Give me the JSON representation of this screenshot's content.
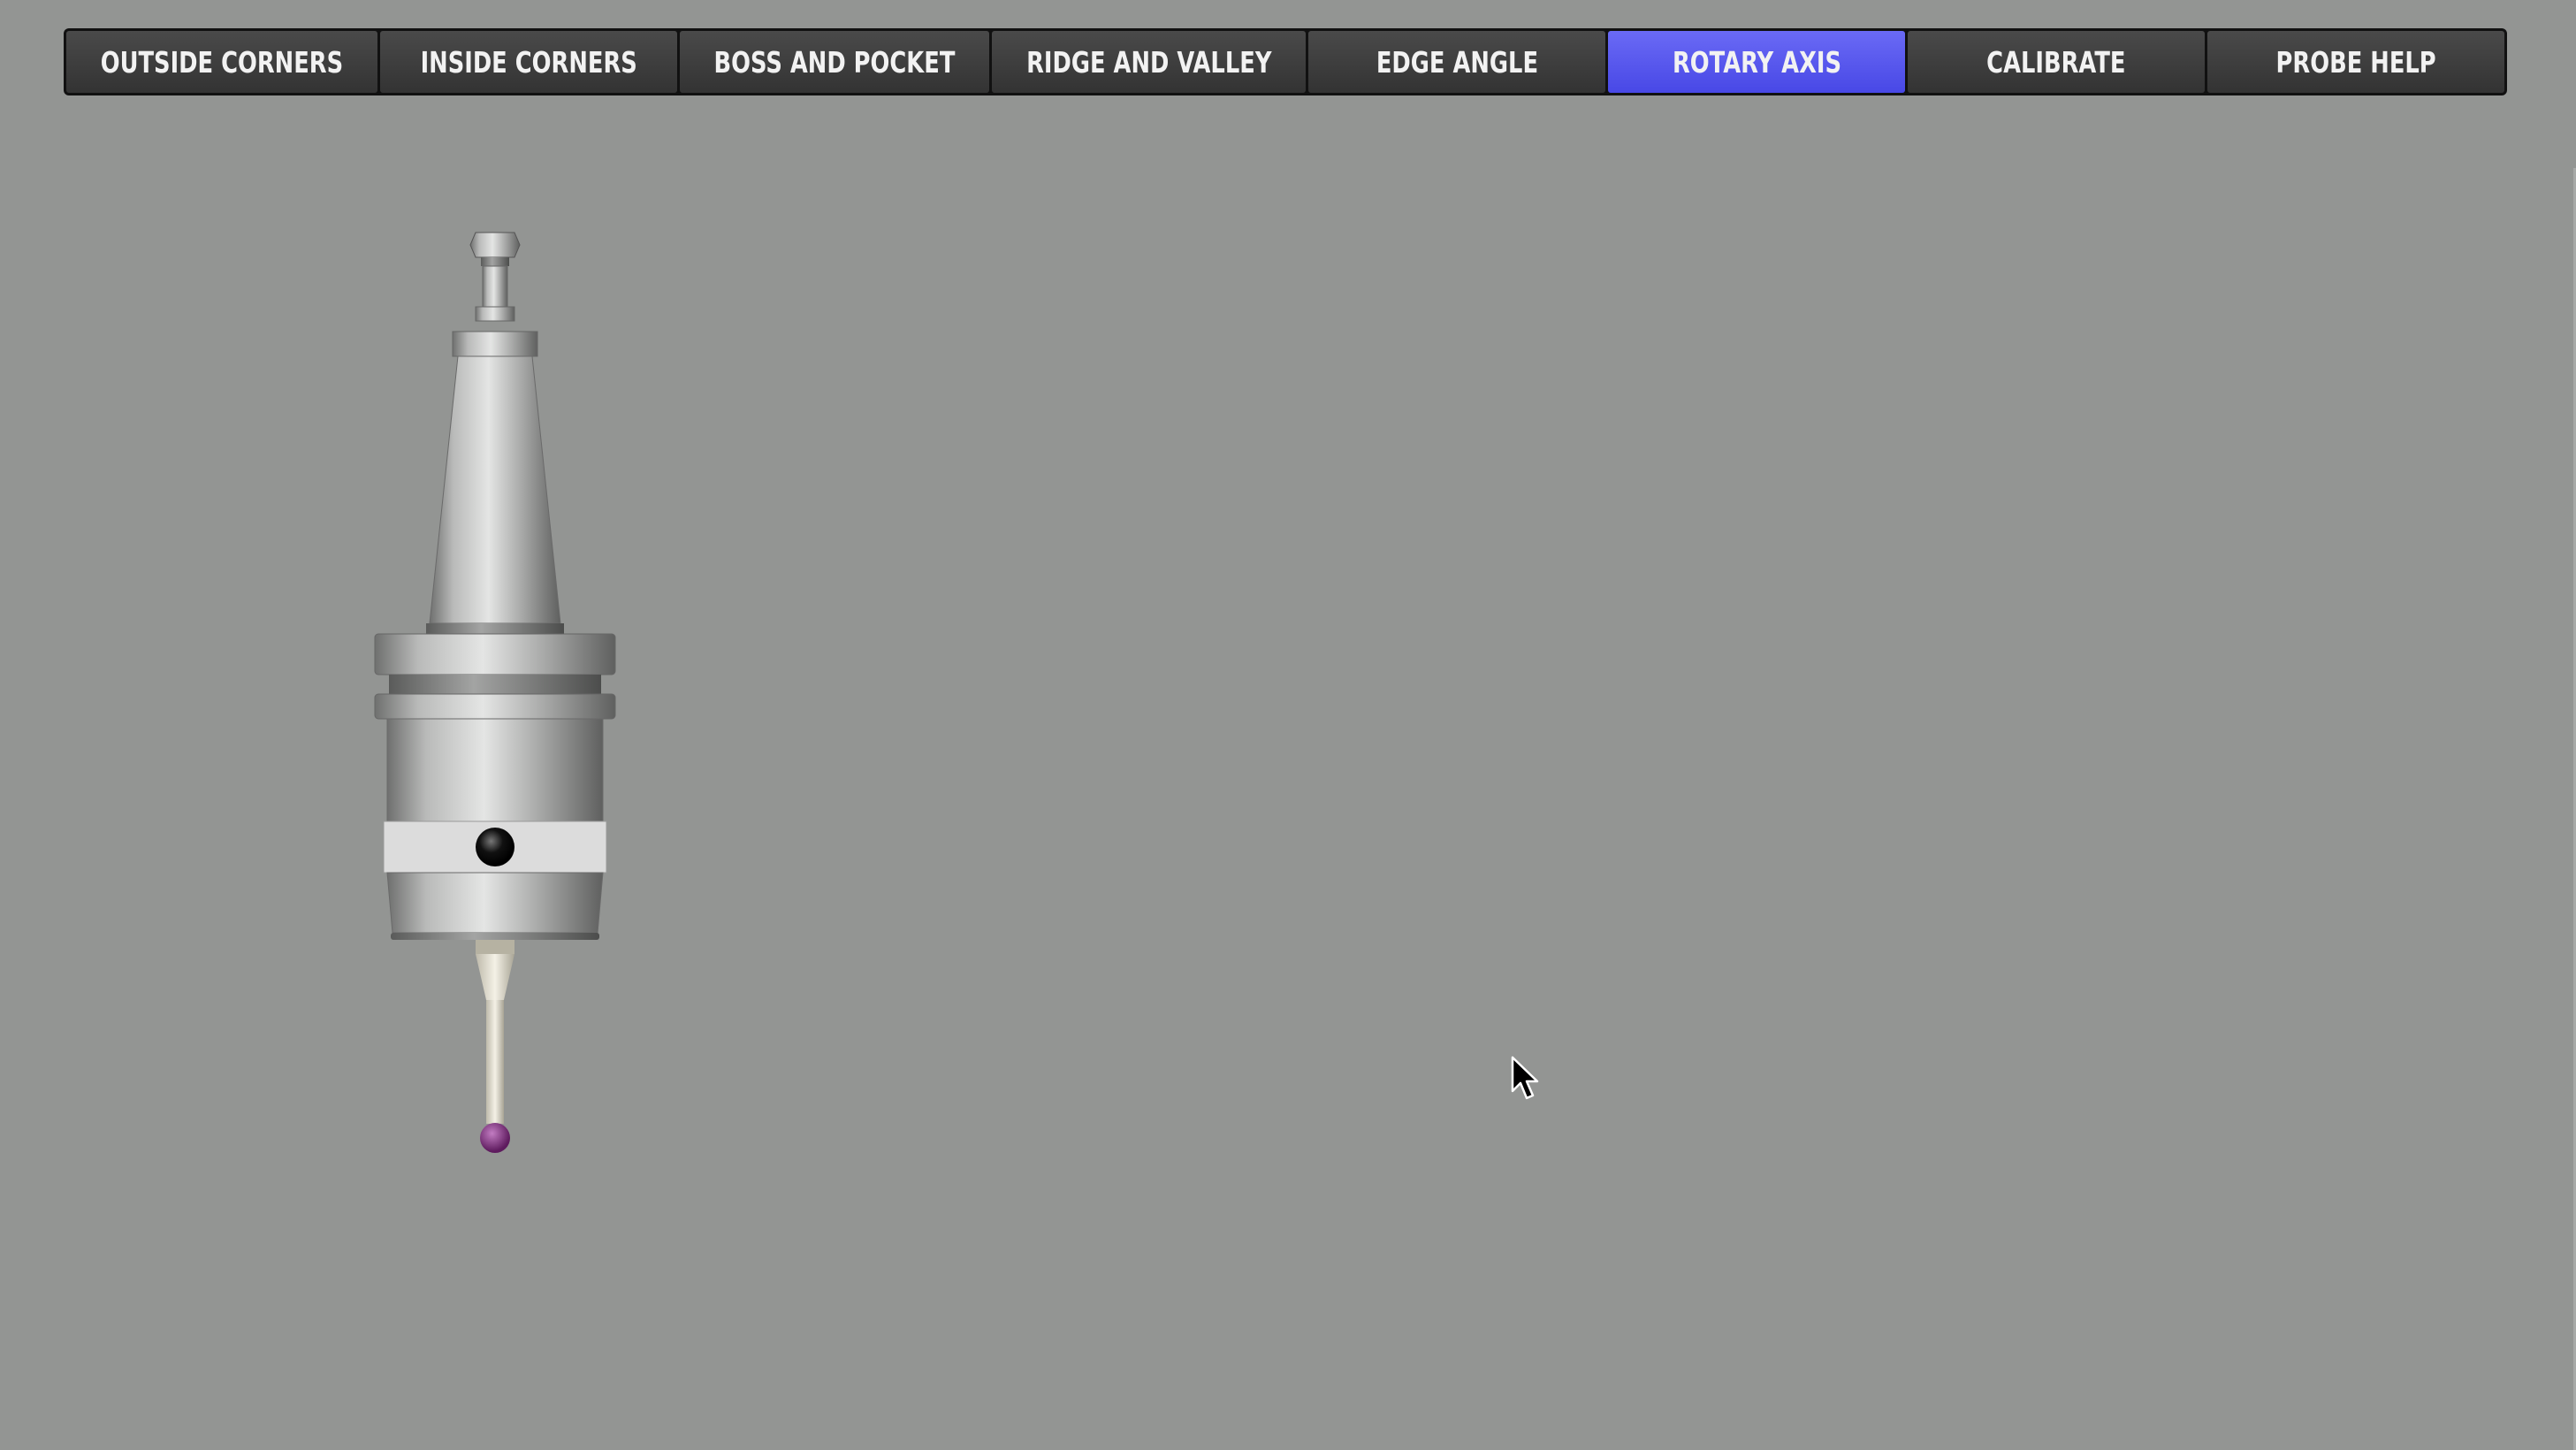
{
  "tabs": [
    {
      "label": "OUTSIDE CORNERS",
      "active": false
    },
    {
      "label": "INSIDE CORNERS",
      "active": false
    },
    {
      "label": "BOSS AND POCKET",
      "active": false
    },
    {
      "label": "RIDGE AND VALLEY",
      "active": false
    },
    {
      "label": "EDGE ANGLE",
      "active": false
    },
    {
      "label": "ROTARY AXIS",
      "active": true
    },
    {
      "label": "CALIBRATE",
      "active": false
    },
    {
      "label": "PROBE HELP",
      "active": false
    }
  ],
  "colors": {
    "background": "#939593",
    "tab_bar": "#111111",
    "tab": "#3e3e3e",
    "tab_active": "#5656ee",
    "tab_text": "#f2f2f2",
    "stylus_ball": "#7a2a7a"
  },
  "icons": {
    "probe": "touch-probe-image",
    "cursor": "mouse-pointer-icon"
  }
}
